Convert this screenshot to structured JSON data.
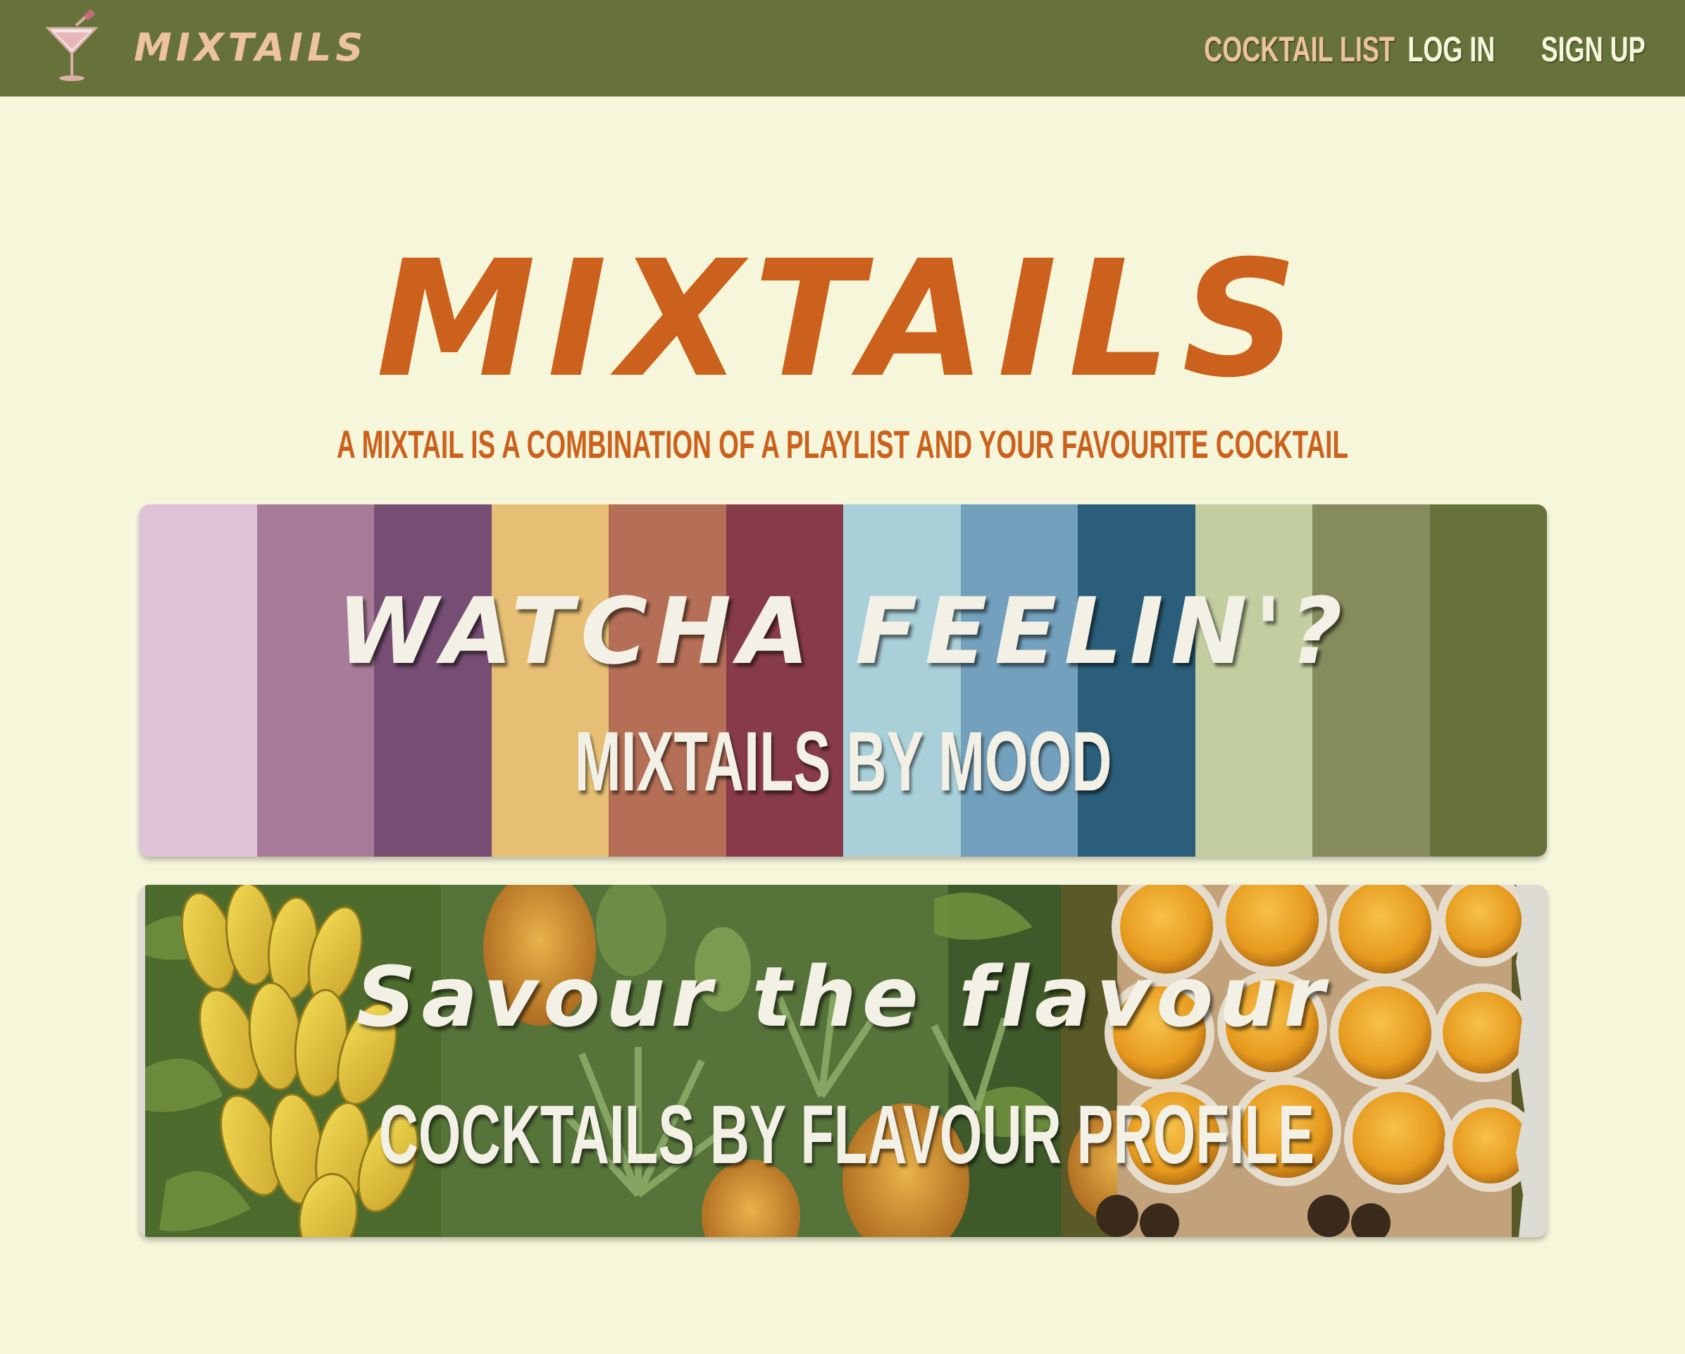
{
  "navbar": {
    "logo_icon": "martini-glass-icon",
    "brand": "MIXTAILS",
    "links": [
      {
        "label": "COCKTAIL LIST",
        "active": true
      },
      {
        "label": "LOG IN",
        "active": false
      },
      {
        "label": "SIGN UP",
        "active": false
      }
    ]
  },
  "hero": {
    "title": "MIXTAILS",
    "subtitle": "A MIXTAIL IS A COMBINATION OF A PLAYLIST AND YOUR FAVOURITE COCKTAIL"
  },
  "cards": {
    "mood": {
      "heading": "WATCHA FEELIN'?",
      "subheading": "MIXTAILS BY MOOD",
      "stripe_colors": [
        "#dfc3d8",
        "#a87b98",
        "#764d73",
        "#e7bf74",
        "#b56f56",
        "#873b48",
        "#a9d0d9",
        "#73a0bc",
        "#2b5e7a",
        "#c2cea0",
        "#858b5c",
        "#67723b"
      ]
    },
    "flavour": {
      "heading": "Savour the flavour",
      "subheading": "COCKTAILS BY FLAVOUR PROFILE",
      "image_icon": "tropical-fruit-image"
    }
  },
  "colors": {
    "navbar_bg": "#67723b",
    "page_bg": "#f6f6db",
    "accent_orange": "#cb611c",
    "nav_active": "#ecc39c",
    "card_text": "#f3f1e6"
  }
}
